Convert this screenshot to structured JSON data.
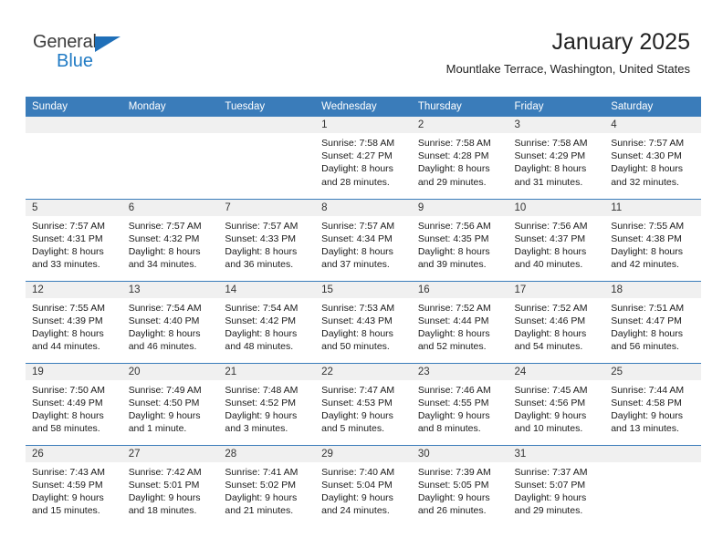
{
  "brand": {
    "name_top": "General",
    "name_bottom": "Blue",
    "triangle_color": "#1f6fb8",
    "blue_color": "#1f7ac4"
  },
  "header": {
    "title": "January 2025",
    "subtitle": "Mountlake Terrace, Washington, United States"
  },
  "colors": {
    "header_blue": "#3a7cba",
    "daynum_band": "#f0f0f0",
    "text": "#1a1a1a"
  },
  "weekday_headers": [
    "Sunday",
    "Monday",
    "Tuesday",
    "Wednesday",
    "Thursday",
    "Friday",
    "Saturday"
  ],
  "weeks": [
    [
      {
        "day": "",
        "sunrise": "",
        "sunset": "",
        "daylight1": "",
        "daylight2": ""
      },
      {
        "day": "",
        "sunrise": "",
        "sunset": "",
        "daylight1": "",
        "daylight2": ""
      },
      {
        "day": "",
        "sunrise": "",
        "sunset": "",
        "daylight1": "",
        "daylight2": ""
      },
      {
        "day": "1",
        "sunrise": "Sunrise: 7:58 AM",
        "sunset": "Sunset: 4:27 PM",
        "daylight1": "Daylight: 8 hours",
        "daylight2": "and 28 minutes."
      },
      {
        "day": "2",
        "sunrise": "Sunrise: 7:58 AM",
        "sunset": "Sunset: 4:28 PM",
        "daylight1": "Daylight: 8 hours",
        "daylight2": "and 29 minutes."
      },
      {
        "day": "3",
        "sunrise": "Sunrise: 7:58 AM",
        "sunset": "Sunset: 4:29 PM",
        "daylight1": "Daylight: 8 hours",
        "daylight2": "and 31 minutes."
      },
      {
        "day": "4",
        "sunrise": "Sunrise: 7:57 AM",
        "sunset": "Sunset: 4:30 PM",
        "daylight1": "Daylight: 8 hours",
        "daylight2": "and 32 minutes."
      }
    ],
    [
      {
        "day": "5",
        "sunrise": "Sunrise: 7:57 AM",
        "sunset": "Sunset: 4:31 PM",
        "daylight1": "Daylight: 8 hours",
        "daylight2": "and 33 minutes."
      },
      {
        "day": "6",
        "sunrise": "Sunrise: 7:57 AM",
        "sunset": "Sunset: 4:32 PM",
        "daylight1": "Daylight: 8 hours",
        "daylight2": "and 34 minutes."
      },
      {
        "day": "7",
        "sunrise": "Sunrise: 7:57 AM",
        "sunset": "Sunset: 4:33 PM",
        "daylight1": "Daylight: 8 hours",
        "daylight2": "and 36 minutes."
      },
      {
        "day": "8",
        "sunrise": "Sunrise: 7:57 AM",
        "sunset": "Sunset: 4:34 PM",
        "daylight1": "Daylight: 8 hours",
        "daylight2": "and 37 minutes."
      },
      {
        "day": "9",
        "sunrise": "Sunrise: 7:56 AM",
        "sunset": "Sunset: 4:35 PM",
        "daylight1": "Daylight: 8 hours",
        "daylight2": "and 39 minutes."
      },
      {
        "day": "10",
        "sunrise": "Sunrise: 7:56 AM",
        "sunset": "Sunset: 4:37 PM",
        "daylight1": "Daylight: 8 hours",
        "daylight2": "and 40 minutes."
      },
      {
        "day": "11",
        "sunrise": "Sunrise: 7:55 AM",
        "sunset": "Sunset: 4:38 PM",
        "daylight1": "Daylight: 8 hours",
        "daylight2": "and 42 minutes."
      }
    ],
    [
      {
        "day": "12",
        "sunrise": "Sunrise: 7:55 AM",
        "sunset": "Sunset: 4:39 PM",
        "daylight1": "Daylight: 8 hours",
        "daylight2": "and 44 minutes."
      },
      {
        "day": "13",
        "sunrise": "Sunrise: 7:54 AM",
        "sunset": "Sunset: 4:40 PM",
        "daylight1": "Daylight: 8 hours",
        "daylight2": "and 46 minutes."
      },
      {
        "day": "14",
        "sunrise": "Sunrise: 7:54 AM",
        "sunset": "Sunset: 4:42 PM",
        "daylight1": "Daylight: 8 hours",
        "daylight2": "and 48 minutes."
      },
      {
        "day": "15",
        "sunrise": "Sunrise: 7:53 AM",
        "sunset": "Sunset: 4:43 PM",
        "daylight1": "Daylight: 8 hours",
        "daylight2": "and 50 minutes."
      },
      {
        "day": "16",
        "sunrise": "Sunrise: 7:52 AM",
        "sunset": "Sunset: 4:44 PM",
        "daylight1": "Daylight: 8 hours",
        "daylight2": "and 52 minutes."
      },
      {
        "day": "17",
        "sunrise": "Sunrise: 7:52 AM",
        "sunset": "Sunset: 4:46 PM",
        "daylight1": "Daylight: 8 hours",
        "daylight2": "and 54 minutes."
      },
      {
        "day": "18",
        "sunrise": "Sunrise: 7:51 AM",
        "sunset": "Sunset: 4:47 PM",
        "daylight1": "Daylight: 8 hours",
        "daylight2": "and 56 minutes."
      }
    ],
    [
      {
        "day": "19",
        "sunrise": "Sunrise: 7:50 AM",
        "sunset": "Sunset: 4:49 PM",
        "daylight1": "Daylight: 8 hours",
        "daylight2": "and 58 minutes."
      },
      {
        "day": "20",
        "sunrise": "Sunrise: 7:49 AM",
        "sunset": "Sunset: 4:50 PM",
        "daylight1": "Daylight: 9 hours",
        "daylight2": "and 1 minute."
      },
      {
        "day": "21",
        "sunrise": "Sunrise: 7:48 AM",
        "sunset": "Sunset: 4:52 PM",
        "daylight1": "Daylight: 9 hours",
        "daylight2": "and 3 minutes."
      },
      {
        "day": "22",
        "sunrise": "Sunrise: 7:47 AM",
        "sunset": "Sunset: 4:53 PM",
        "daylight1": "Daylight: 9 hours",
        "daylight2": "and 5 minutes."
      },
      {
        "day": "23",
        "sunrise": "Sunrise: 7:46 AM",
        "sunset": "Sunset: 4:55 PM",
        "daylight1": "Daylight: 9 hours",
        "daylight2": "and 8 minutes."
      },
      {
        "day": "24",
        "sunrise": "Sunrise: 7:45 AM",
        "sunset": "Sunset: 4:56 PM",
        "daylight1": "Daylight: 9 hours",
        "daylight2": "and 10 minutes."
      },
      {
        "day": "25",
        "sunrise": "Sunrise: 7:44 AM",
        "sunset": "Sunset: 4:58 PM",
        "daylight1": "Daylight: 9 hours",
        "daylight2": "and 13 minutes."
      }
    ],
    [
      {
        "day": "26",
        "sunrise": "Sunrise: 7:43 AM",
        "sunset": "Sunset: 4:59 PM",
        "daylight1": "Daylight: 9 hours",
        "daylight2": "and 15 minutes."
      },
      {
        "day": "27",
        "sunrise": "Sunrise: 7:42 AM",
        "sunset": "Sunset: 5:01 PM",
        "daylight1": "Daylight: 9 hours",
        "daylight2": "and 18 minutes."
      },
      {
        "day": "28",
        "sunrise": "Sunrise: 7:41 AM",
        "sunset": "Sunset: 5:02 PM",
        "daylight1": "Daylight: 9 hours",
        "daylight2": "and 21 minutes."
      },
      {
        "day": "29",
        "sunrise": "Sunrise: 7:40 AM",
        "sunset": "Sunset: 5:04 PM",
        "daylight1": "Daylight: 9 hours",
        "daylight2": "and 24 minutes."
      },
      {
        "day": "30",
        "sunrise": "Sunrise: 7:39 AM",
        "sunset": "Sunset: 5:05 PM",
        "daylight1": "Daylight: 9 hours",
        "daylight2": "and 26 minutes."
      },
      {
        "day": "31",
        "sunrise": "Sunrise: 7:37 AM",
        "sunset": "Sunset: 5:07 PM",
        "daylight1": "Daylight: 9 hours",
        "daylight2": "and 29 minutes."
      },
      {
        "day": "",
        "sunrise": "",
        "sunset": "",
        "daylight1": "",
        "daylight2": ""
      }
    ]
  ]
}
